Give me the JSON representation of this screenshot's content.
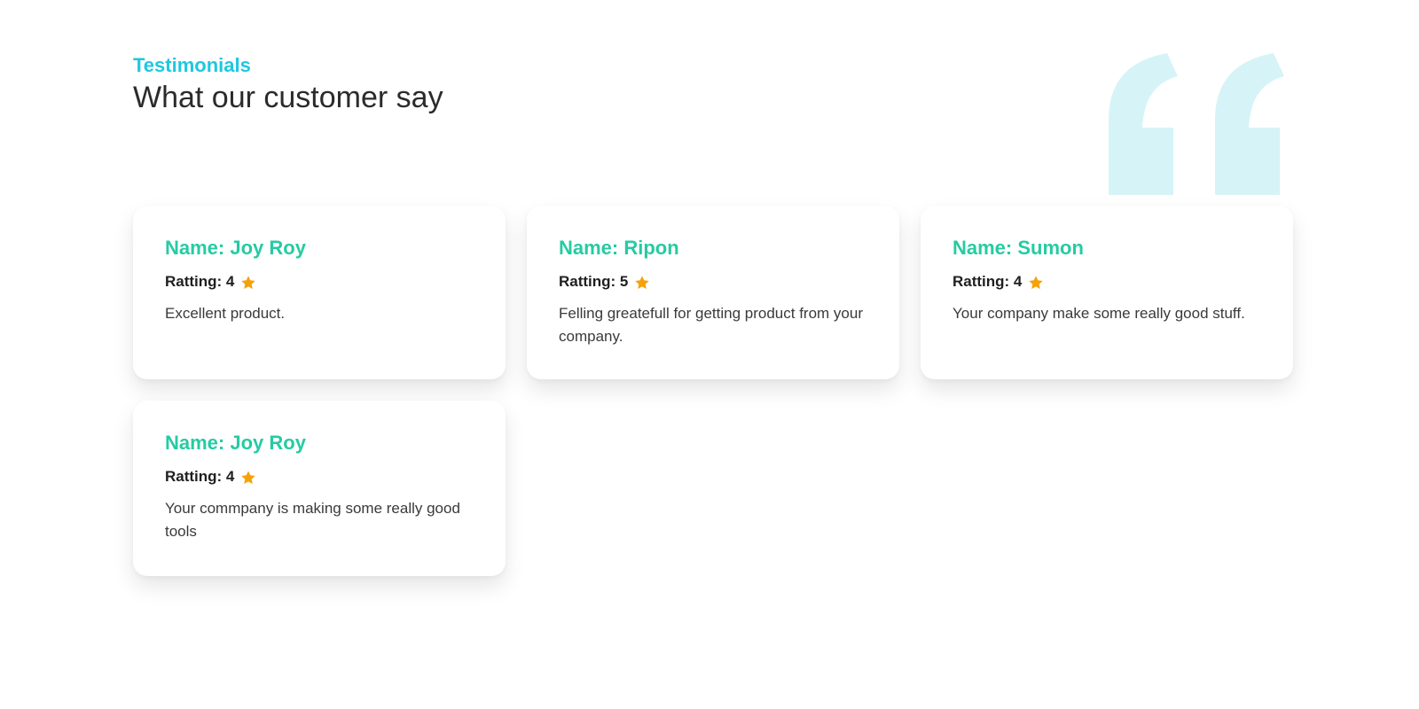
{
  "header": {
    "eyebrow": "Testimonials",
    "title": "What our customer say"
  },
  "decor": {
    "quote_icon": "quote-mark-icon",
    "quote_color": "#d6f4f7"
  },
  "colors": {
    "accent": "#1ec8e0",
    "name": "#26cba3",
    "star": "#f5a20a"
  },
  "testimonials": [
    {
      "name": "Name: Joy Roy",
      "rating_label": "Ratting: 4",
      "rating": 4,
      "star_icon": "star-icon",
      "text": "Excellent product."
    },
    {
      "name": "Name: Ripon",
      "rating_label": "Ratting: 5",
      "rating": 5,
      "star_icon": "star-icon",
      "text": "Felling greatefull for getting product from your company."
    },
    {
      "name": "Name: Sumon",
      "rating_label": "Ratting: 4",
      "rating": 4,
      "star_icon": "star-icon",
      "text": "Your company make some really good stuff."
    },
    {
      "name": "Name: Joy Roy",
      "rating_label": "Ratting: 4",
      "rating": 4,
      "star_icon": "star-icon",
      "text": "Your commpany is making some really good tools"
    }
  ]
}
